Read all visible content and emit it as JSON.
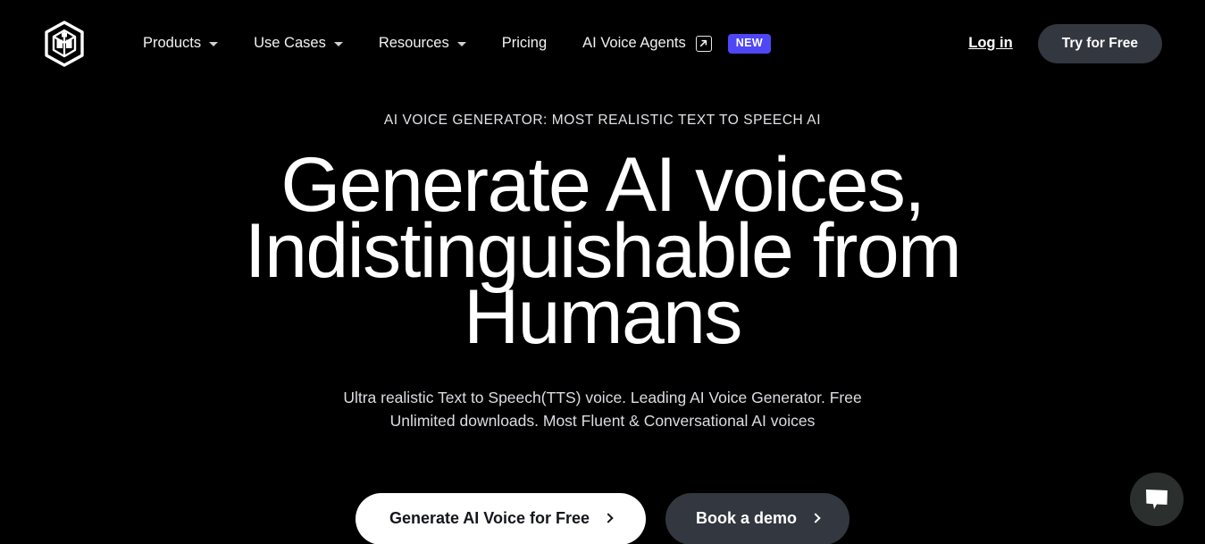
{
  "theme": {
    "background": "#000000",
    "text_primary": "#ffffff",
    "text_muted": "#dcdce2",
    "badge_accent": "#4f46f5",
    "button_dark": "#33373f",
    "button_light": "#ffffff",
    "chat_bubble_bg": "#2b2f2d"
  },
  "header": {
    "logo": "cube-hexagon-logo",
    "nav_items": [
      {
        "label": "Products",
        "icon": "chevron-down-icon",
        "has_caret": true,
        "external": false,
        "badge": null
      },
      {
        "label": "Use Cases",
        "icon": "chevron-down-icon",
        "has_caret": true,
        "external": false,
        "badge": null
      },
      {
        "label": "Resources",
        "icon": "chevron-down-icon",
        "has_caret": true,
        "external": false,
        "badge": null
      },
      {
        "label": "Pricing",
        "icon": null,
        "has_caret": false,
        "external": false,
        "badge": null
      },
      {
        "label": "AI Voice Agents",
        "icon": "external-link-icon",
        "has_caret": false,
        "external": true,
        "badge": "NEW"
      }
    ],
    "login_label": "Log in",
    "try_label": "Try for Free"
  },
  "hero": {
    "eyebrow": "AI VOICE GENERATOR: MOST REALISTIC TEXT TO SPEECH AI",
    "headline_line1": "Generate AI voices,",
    "headline_line2": "Indistinguishable from",
    "headline_line3": "Humans",
    "subhead_line1": "Ultra realistic Text to Speech(TTS) voice. Leading AI Voice Generator. Free",
    "subhead_line2": "Unlimited downloads. Most Fluent & Conversational AI voices",
    "cta_primary": "Generate AI Voice for Free",
    "cta_secondary": "Book a demo"
  },
  "chat": {
    "icon": "chat-bubble-icon"
  }
}
